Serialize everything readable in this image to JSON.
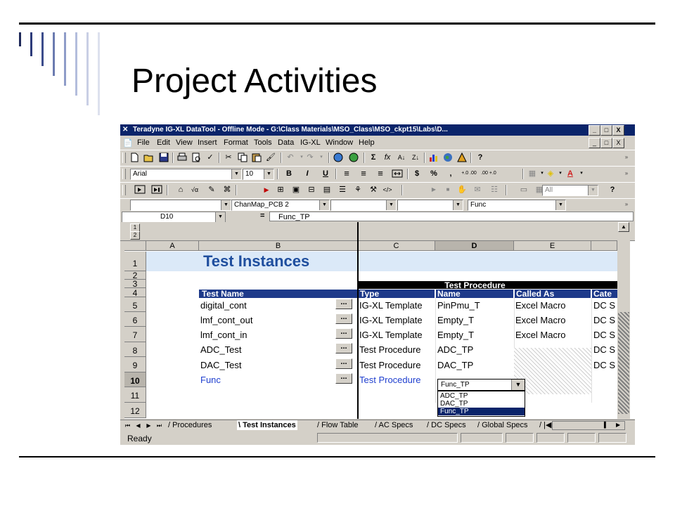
{
  "slide": {
    "title": "Project Activities",
    "deco_bar_colors": [
      "#1f2a5a",
      "#2d3b7a",
      "#3d4d8c",
      "#6b7bb0",
      "#8f9cc8",
      "#b3bddc",
      "#c9cfe5",
      "#dde1ee"
    ]
  },
  "window": {
    "title": "Teradyne IG-XL DataTool - Offline Mode - G:\\Class Materials\\MSO_Class\\MSO_ckpt15\\Labs\\D...",
    "icon": "excel-icon",
    "controls": [
      "_",
      "□",
      "X"
    ]
  },
  "menu": {
    "items": [
      "File",
      "Edit",
      "View",
      "Insert",
      "Format",
      "Tools",
      "Data",
      "IG-XL",
      "Window",
      "Help"
    ],
    "doc_controls": [
      "_",
      "□",
      "X"
    ]
  },
  "toolbar_format": {
    "font": "Arial",
    "size": "10",
    "bold": "B",
    "italic": "I",
    "underline": "U",
    "currency": "$",
    "percent": "%",
    "comma": ",",
    "inc_decimal": "+.0 .00",
    "dec_decimal": ".00 +.0"
  },
  "toolbar_combos": {
    "combo1": "",
    "combo2": "ChanMap_PCB 2",
    "combo3": "",
    "combo4": "",
    "combo5": "Func"
  },
  "toolbar_igxl": {
    "all_combo": "All"
  },
  "formula_bar": {
    "name_box": "D10",
    "equals": "=",
    "value": "Func_TP"
  },
  "sheet": {
    "outline_levels": [
      "1",
      "2"
    ],
    "columns": [
      "A",
      "B",
      "C",
      "D",
      "E",
      "Cate"
    ],
    "rows": [
      "1",
      "2",
      "3",
      "4",
      "5",
      "6",
      "7",
      "8",
      "9",
      "10",
      "11",
      "12"
    ],
    "selected_row": "10",
    "selected_col": "D",
    "banner_title": "Test Instances",
    "group_header": "Test Procedure",
    "headers": [
      "Test Name",
      "Type",
      "Name",
      "Called As",
      "Cate"
    ],
    "data_rows": [
      {
        "name": "digital_cont",
        "type": "IG-XL Template",
        "proc": "PinPmu_T",
        "called": "Excel Macro",
        "cat": "DC S"
      },
      {
        "name": "lmf_cont_out",
        "type": "IG-XL Template",
        "proc": "Empty_T",
        "called": "Excel Macro",
        "cat": "DC S"
      },
      {
        "name": "lmf_cont_in",
        "type": "IG-XL Template",
        "proc": "Empty_T",
        "called": "Excel Macro",
        "cat": "DC S"
      },
      {
        "name": "ADC_Test",
        "type": "Test Procedure",
        "proc": "ADC_TP",
        "called": "",
        "cat": "DC S"
      },
      {
        "name": "DAC_Test",
        "type": "Test Procedure",
        "proc": "DAC_TP",
        "called": "",
        "cat": "DC S"
      },
      {
        "name": "Func",
        "type": "Test Procedure",
        "proc": "",
        "called": "",
        "cat": ""
      }
    ],
    "browse_button": "...",
    "dropdown": {
      "value": "Func_TP",
      "options": [
        "ADC_TP",
        "DAC_TP",
        "Func_TP"
      ],
      "selected": "Func_TP"
    }
  },
  "tabs": {
    "items": [
      "Procedures",
      "Test Instances",
      "Flow Table",
      "AC Specs",
      "DC Specs",
      "Global Specs"
    ],
    "active": "Test Instances"
  },
  "status": {
    "text": "Ready"
  }
}
